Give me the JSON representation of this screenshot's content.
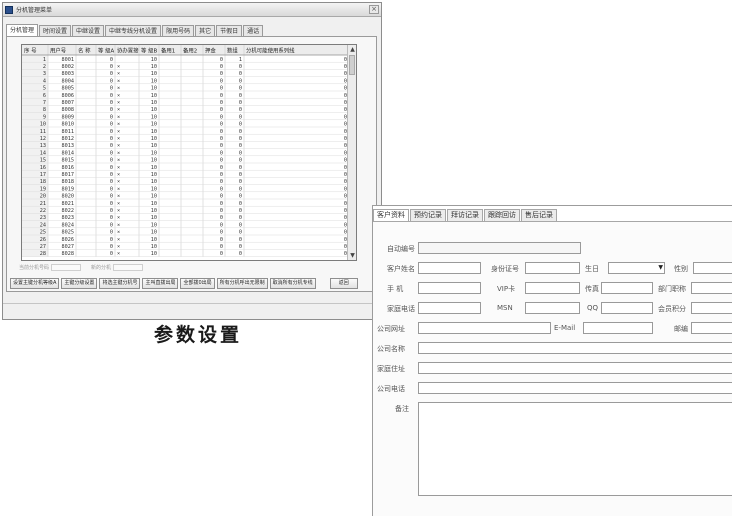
{
  "win1": {
    "title": "分机管理菜单",
    "close_glyph": "×",
    "tabs": [
      "分机管理",
      "时间设置",
      "中继设置",
      "中继专线分机设置",
      "限用号码",
      "其它",
      "节假日",
      "通话"
    ],
    "columns": [
      "序 号",
      "用户号",
      "名 称",
      "等 级A",
      "协办置接",
      "等 级B",
      "备用1",
      "备用2",
      "押金",
      "数组",
      "分机可能使用系列线"
    ],
    "rows": [
      [
        "1",
        "8001",
        "",
        "0",
        "",
        "10",
        "",
        "",
        "0",
        "1",
        "0"
      ],
      [
        "2",
        "8002",
        "",
        "0",
        "×",
        "10",
        "",
        "",
        "0",
        "0",
        "0"
      ],
      [
        "3",
        "8003",
        "",
        "0",
        "×",
        "10",
        "",
        "",
        "0",
        "0",
        "0"
      ],
      [
        "4",
        "8004",
        "",
        "0",
        "×",
        "10",
        "",
        "",
        "0",
        "0",
        "0"
      ],
      [
        "5",
        "8005",
        "",
        "0",
        "×",
        "10",
        "",
        "",
        "0",
        "0",
        "0"
      ],
      [
        "6",
        "8006",
        "",
        "0",
        "×",
        "10",
        "",
        "",
        "0",
        "0",
        "0"
      ],
      [
        "7",
        "8007",
        "",
        "0",
        "×",
        "10",
        "",
        "",
        "0",
        "0",
        "0"
      ],
      [
        "8",
        "8008",
        "",
        "0",
        "×",
        "10",
        "",
        "",
        "0",
        "0",
        "0"
      ],
      [
        "9",
        "8009",
        "",
        "0",
        "×",
        "10",
        "",
        "",
        "0",
        "0",
        "0"
      ],
      [
        "10",
        "8010",
        "",
        "0",
        "×",
        "10",
        "",
        "",
        "0",
        "0",
        "0"
      ],
      [
        "11",
        "8011",
        "",
        "0",
        "×",
        "10",
        "",
        "",
        "0",
        "0",
        "0"
      ],
      [
        "12",
        "8012",
        "",
        "0",
        "×",
        "10",
        "",
        "",
        "0",
        "0",
        "0"
      ],
      [
        "13",
        "8013",
        "",
        "0",
        "×",
        "10",
        "",
        "",
        "0",
        "0",
        "0"
      ],
      [
        "14",
        "8014",
        "",
        "0",
        "×",
        "10",
        "",
        "",
        "0",
        "0",
        "0"
      ],
      [
        "15",
        "8015",
        "",
        "0",
        "×",
        "10",
        "",
        "",
        "0",
        "0",
        "0"
      ],
      [
        "16",
        "8016",
        "",
        "0",
        "×",
        "10",
        "",
        "",
        "0",
        "0",
        "0"
      ],
      [
        "17",
        "8017",
        "",
        "0",
        "×",
        "10",
        "",
        "",
        "0",
        "0",
        "0"
      ],
      [
        "18",
        "8018",
        "",
        "0",
        "×",
        "10",
        "",
        "",
        "0",
        "0",
        "0"
      ],
      [
        "19",
        "8019",
        "",
        "0",
        "×",
        "10",
        "",
        "",
        "0",
        "0",
        "0"
      ],
      [
        "20",
        "8020",
        "",
        "0",
        "×",
        "10",
        "",
        "",
        "0",
        "0",
        "0"
      ],
      [
        "21",
        "8021",
        "",
        "0",
        "×",
        "10",
        "",
        "",
        "0",
        "0",
        "0"
      ],
      [
        "22",
        "8022",
        "",
        "0",
        "×",
        "10",
        "",
        "",
        "0",
        "0",
        "0"
      ],
      [
        "23",
        "8023",
        "",
        "0",
        "×",
        "10",
        "",
        "",
        "0",
        "0",
        "0"
      ],
      [
        "24",
        "8024",
        "",
        "0",
        "×",
        "10",
        "",
        "",
        "0",
        "0",
        "0"
      ],
      [
        "25",
        "8025",
        "",
        "0",
        "×",
        "10",
        "",
        "",
        "0",
        "0",
        "0"
      ],
      [
        "26",
        "8026",
        "",
        "0",
        "×",
        "10",
        "",
        "",
        "0",
        "0",
        "0"
      ],
      [
        "27",
        "8027",
        "",
        "0",
        "×",
        "10",
        "",
        "",
        "0",
        "0",
        "0"
      ],
      [
        "28",
        "8028",
        "",
        "0",
        "×",
        "10",
        "",
        "",
        "0",
        "0",
        "0"
      ]
    ],
    "status_label_1": "当前分机号码",
    "status_label_2": "新的分机",
    "buttons": [
      "设置主键分机等级A",
      "主键分级设置",
      "将选主键分机号",
      "主叫直拨出局",
      "全部拨0出局",
      "所有分机呼出无限制",
      "取消所有分机专线",
      "返回"
    ]
  },
  "caption": "参数设置",
  "win2": {
    "tabs": [
      "客户资料",
      "预约记录",
      "拜访记录",
      "跟踪回访",
      "售后记录"
    ],
    "labels": {
      "auto_id": "自动编号",
      "name": "客户姓名",
      "id_card": "身份证号",
      "birthday": "生日",
      "gender": "性别",
      "mobile": "手 机",
      "vip": "VIP卡",
      "fax": "传真",
      "department": "部门职称",
      "home_phone": "家庭电话",
      "msn": "MSN",
      "qq": "QQ",
      "points": "会员积分",
      "company_site": "公司网址",
      "email": "E-Mail",
      "postcode": "邮编",
      "company_name": "公司名称",
      "home_addr": "家庭住址",
      "company_phone": "公司电话",
      "notes": "备注"
    },
    "dropdown_glyph": "▼"
  }
}
